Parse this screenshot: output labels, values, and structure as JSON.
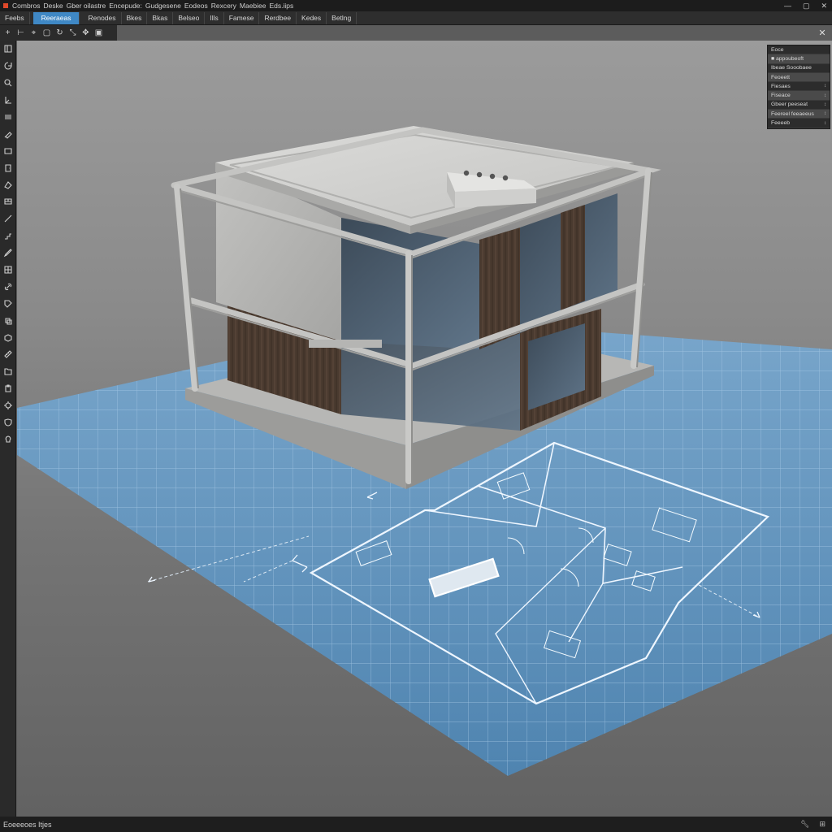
{
  "menu": [
    "Combros",
    "Deske",
    "Gber oilastre",
    "Encepude:",
    "Gudgesene",
    "Eodeos",
    "Rexcery",
    "Maebiee",
    "Eds.iips"
  ],
  "window_controls": {
    "minimize": "—",
    "maximize": "▢",
    "close": "✕"
  },
  "tabs": [
    "Feebs",
    "Reeraeas",
    "Renodes",
    "Bkes",
    "Bkas",
    "Belseo",
    "Ills",
    "Famese",
    "Rerdbee",
    "Kedes",
    "Betlng"
  ],
  "active_tab_index": 1,
  "toolbar_icons": [
    "plus-icon",
    "dimension-icon",
    "snap-icon",
    "select-box-icon",
    "rotate-icon",
    "scale-icon",
    "move-icon",
    "align-icon"
  ],
  "tool_icons": [
    "panel-icon",
    "orbit-icon",
    "zoom-icon",
    "axis-icon",
    "layers-icon",
    "paint-icon",
    "rectangle-icon",
    "door-icon",
    "eraser-icon",
    "wall-icon",
    "line-icon",
    "stairs-icon",
    "pencil-icon",
    "window-icon",
    "link-icon",
    "tag-icon",
    "copy-icon",
    "box-icon",
    "measure-icon",
    "folder-icon",
    "clipboard-icon",
    "settings-icon",
    "shield-icon",
    "light-icon"
  ],
  "properties": {
    "rows": [
      {
        "label": "Eoce",
        "value": ""
      },
      {
        "label": "■ appoubeoft",
        "value": ""
      },
      {
        "label": "Ibeae Sooobaee",
        "value": ""
      },
      {
        "label": "Feoeett",
        "value": ""
      },
      {
        "label": "Fiesaes",
        "value": "↕"
      },
      {
        "label": "Fiseace",
        "value": "↕"
      },
      {
        "label": "Gbeer peeseat",
        "value": "↕"
      },
      {
        "label": "Feereel feeaeeus",
        "value": "↕"
      },
      {
        "label": "Feeeeb",
        "value": "↕"
      }
    ]
  },
  "status": {
    "text": "Eoeeeoes Itjes",
    "icons": [
      "wrench-icon",
      "grid-icon"
    ]
  },
  "colors": {
    "accent": "#3f88c5",
    "grid_blue": "#5a8fb8",
    "concrete": "#c9c9c7",
    "wood": "#4a3b30"
  }
}
